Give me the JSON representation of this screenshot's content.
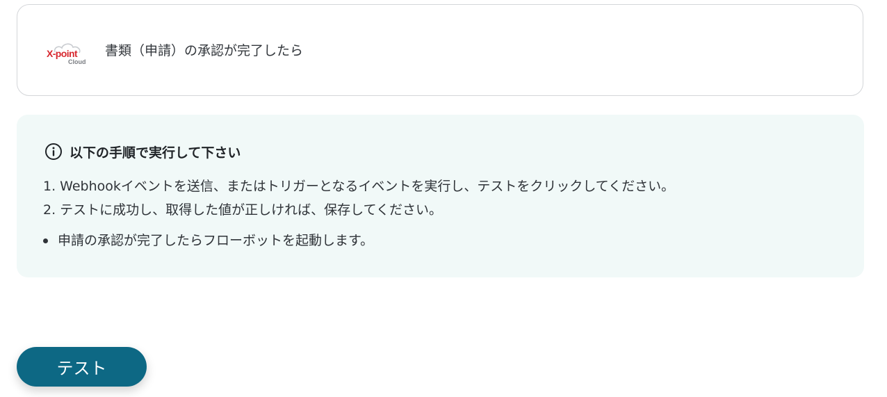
{
  "trigger": {
    "logo_text": "X-point",
    "logo_subtext": "Cloud",
    "title": "書類（申請）の承認が完了したら"
  },
  "info": {
    "heading": "以下の手順で実行して下さい",
    "steps": [
      "1. Webhookイベントを送信、またはトリガーとなるイベントを実行し、テストをクリックしてください。",
      "2. テストに成功し、取得した値が正しければ、保存してください。"
    ],
    "bullets": [
      "申請の承認が完了したらフローボットを起動します。"
    ]
  },
  "actions": {
    "test_label": "テスト"
  },
  "colors": {
    "accent": "#0d6884",
    "info_bg": "#f1f9f8",
    "logo_red": "#d7282f"
  }
}
